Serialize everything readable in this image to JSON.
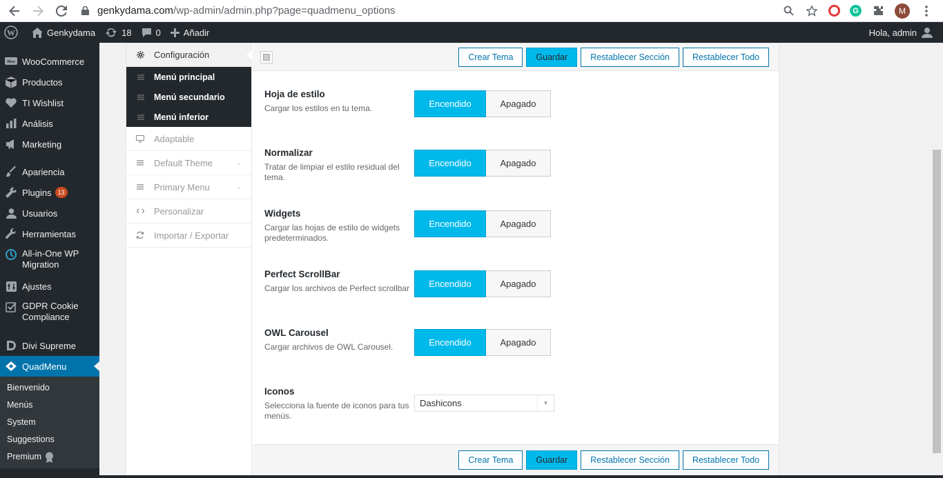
{
  "browser": {
    "url_host": "genkydama.com",
    "url_path": "/wp-admin/admin.php?page=quadmenu_options",
    "profile_initial": "M"
  },
  "adminbar": {
    "site_name": "Genkydama",
    "updates_count": "18",
    "comments_count": "0",
    "add_new_label": "Añadir",
    "howdy": "Hola, admin"
  },
  "sidebar": {
    "items": [
      {
        "label": "WooCommerce"
      },
      {
        "label": "Productos"
      },
      {
        "label": "TI Wishlist"
      },
      {
        "label": "Análisis"
      },
      {
        "label": "Marketing"
      },
      {
        "label": "Apariencia"
      },
      {
        "label": "Plugins",
        "badge": "13"
      },
      {
        "label": "Usuarios"
      },
      {
        "label": "Herramientas"
      },
      {
        "label": "All-in-One WP Migration"
      },
      {
        "label": "Ajustes"
      },
      {
        "label": "GDPR Cookie Compliance"
      },
      {
        "label": "Divi Supreme"
      },
      {
        "label": "QuadMenu"
      }
    ],
    "submenu": [
      {
        "label": "Bienvenido"
      },
      {
        "label": "Menús"
      },
      {
        "label": "System"
      },
      {
        "label": "Suggestions"
      },
      {
        "label": "Premium"
      }
    ]
  },
  "quadmenu_nav": {
    "config": "Configuración",
    "sub_items": [
      "Menú principal",
      "Menú secundario",
      "Menú inferior"
    ],
    "items": [
      "Adaptable",
      "Default Theme",
      "Primary Menu",
      "Personalizar",
      "Importar / Exportar"
    ]
  },
  "toolbar": {
    "create_theme": "Crear Tema",
    "save": "Guardar",
    "reset_section": "Restablecer Sección",
    "reset_all": "Restablecer Todo"
  },
  "settings": [
    {
      "title": "Hoja de estilo",
      "desc": "Cargar los estilos en tu tema.",
      "on": "Encendido",
      "off": "Apagado",
      "value": "on"
    },
    {
      "title": "Normalizar",
      "desc": "Tratar de limpiar el estilo residual del tema.",
      "on": "Encendido",
      "off": "Apagado",
      "value": "on"
    },
    {
      "title": "Widgets",
      "desc": "Cargar las hojas de estilo de widgets predeterminados.",
      "on": "Encendido",
      "off": "Apagado",
      "value": "on"
    },
    {
      "title": "Perfect ScrollBar",
      "desc": "Cargar los archivos de Perfect scrollbar",
      "on": "Encendido",
      "off": "Apagado",
      "value": "on"
    },
    {
      "title": "OWL Carousel",
      "desc": "Cargar archivos de OWL Carousel.",
      "on": "Encendido",
      "off": "Apagado",
      "value": "on"
    },
    {
      "title": "Iconos",
      "desc": "Selecciona la fuente de iconos para tus menús.",
      "select_value": "Dashicons"
    }
  ],
  "colors": {
    "accent": "#00b9eb",
    "wp_blue": "#0073aa",
    "admin_dark": "#23282d",
    "badge": "#ca4a1f"
  }
}
